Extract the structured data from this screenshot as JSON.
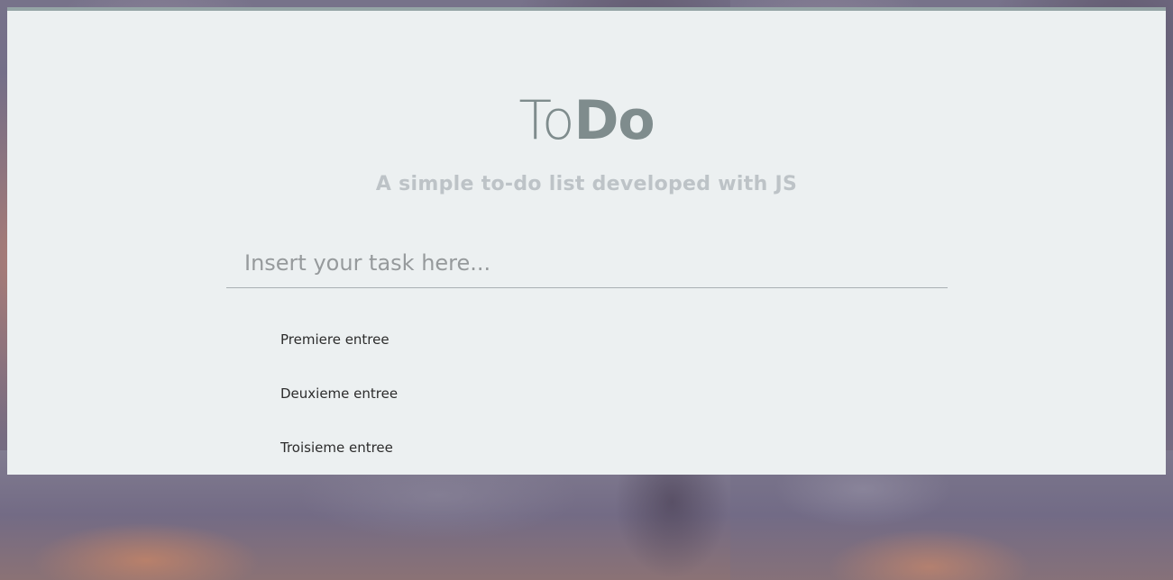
{
  "app": {
    "title_light": "To",
    "title_bold": "Do",
    "subtitle": "A simple to-do list developed with JS"
  },
  "input": {
    "placeholder": "Insert your task here...",
    "value": ""
  },
  "tasks": [
    {
      "label": "Premiere entree"
    },
    {
      "label": "Deuxieme entree"
    },
    {
      "label": "Troisieme entree"
    }
  ],
  "colors": {
    "panel_background": "#ecf0f1",
    "panel_top_border": "#95a5a6",
    "title": "#7f8c8d",
    "subtitle": "#bdc3c7",
    "task_text": "#2c2c2c"
  }
}
